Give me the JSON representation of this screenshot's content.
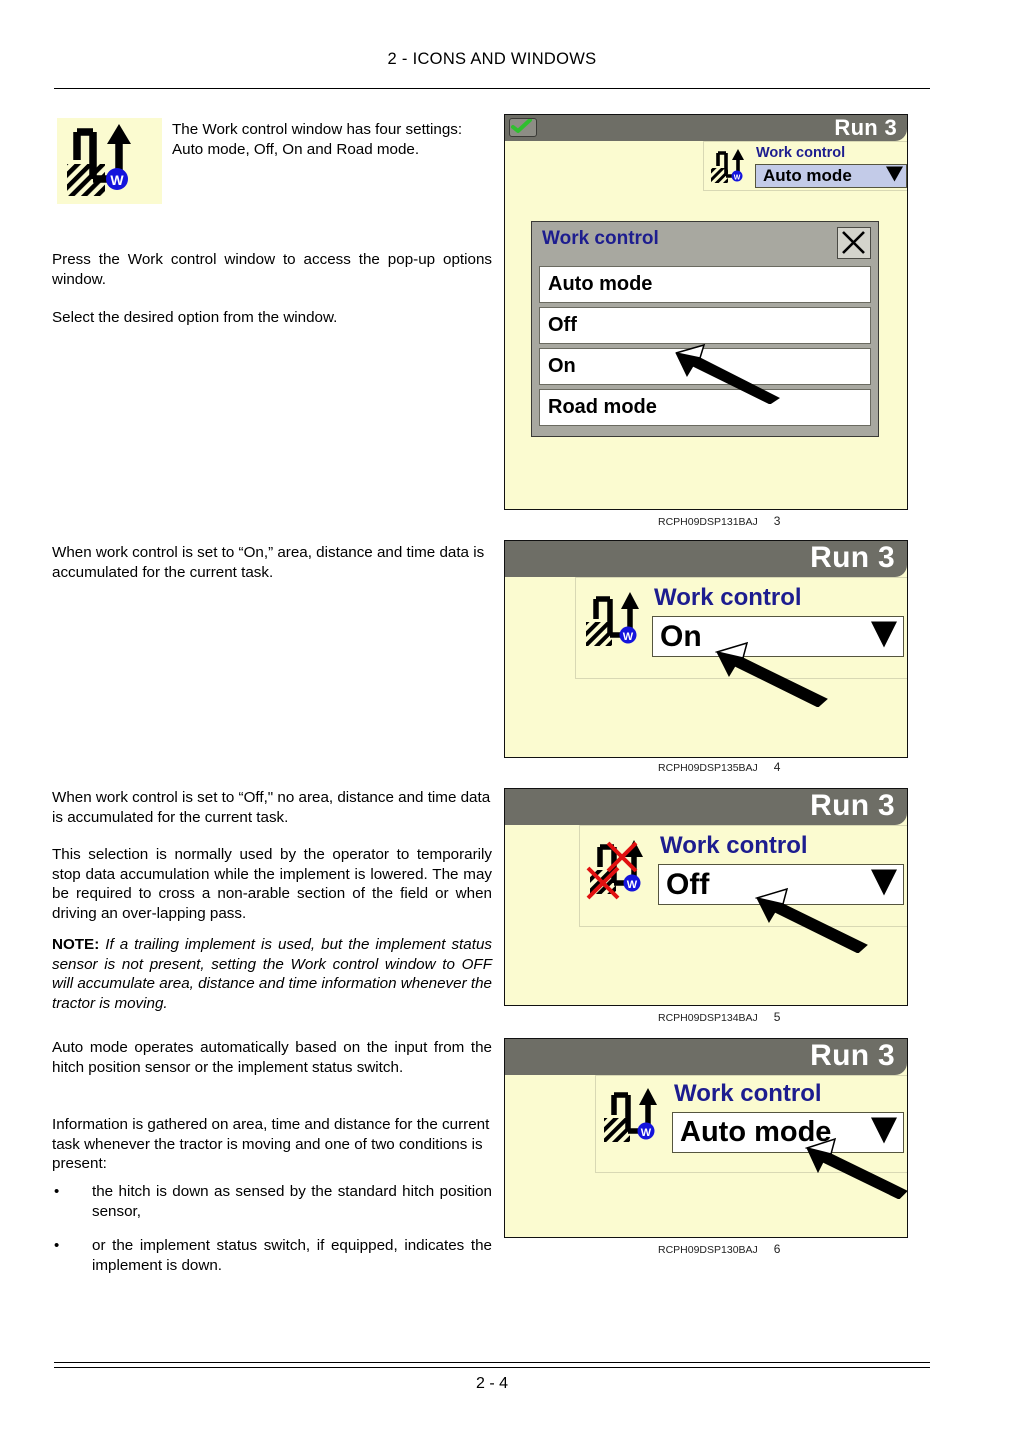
{
  "header": {
    "title": "2 - ICONS AND WINDOWS"
  },
  "footer": {
    "page_number": "2 - 4"
  },
  "body": {
    "intro_paragraph": "The Work control window has four settings: Auto mode, Off, On and Road mode.",
    "paragraph_press": "Press the Work control window to access the pop-up options window.",
    "paragraph_select": "Select the desired option from the window.",
    "paragraph_on": "When work control is set to “On,” area, distance and time data is accumulated for the current task.",
    "paragraph_off": "When work control is set to “Off,\" no area, distance and time data is accumulated for the current task.",
    "paragraph_off_detail": "This selection is normally used by the operator to temporarily stop data accumulation while the implement is lowered. The may be required to cross a non-arable section of the field or when driving an over-lapping pass.",
    "note_label": "NOTE:",
    "note_text": " If a trailing implement is used, but the implement status sensor is not present, setting the Work control window to OFF will accumulate area, distance and time information whenever the tractor is moving.",
    "paragraph_auto": "Auto mode operates automatically based on the input from the hitch position sensor or the implement status switch.",
    "paragraph_info": "Information is gathered on area, time and distance for the current task whenever the tractor is moving and one of two conditions is present:",
    "bullets": [
      {
        "marker": "•",
        "text": "the hitch is down as sensed by the standard hitch position sensor,"
      },
      {
        "marker": "•",
        "text": "or the implement status switch, if equipped, indicates the implement is down."
      }
    ]
  },
  "figures": [
    {
      "id": "figure-3",
      "caption_code": "RCPH09DSP131BAJ",
      "caption_number": "3",
      "titlebar_run": "Run 3",
      "widget_label": "Work control",
      "widget_value": "Auto mode",
      "popup": {
        "title": "Work control",
        "close_label": "×",
        "options": [
          "Auto mode",
          "Off",
          "On",
          "Road mode"
        ]
      }
    },
    {
      "id": "figure-4",
      "caption_code": "RCPH09DSP135BAJ",
      "caption_number": "4",
      "titlebar_run": "Run 3",
      "widget_label": "Work control",
      "widget_value": "On"
    },
    {
      "id": "figure-5",
      "caption_code": "RCPH09DSP134BAJ",
      "caption_number": "5",
      "titlebar_run": "Run 3",
      "widget_label": "Work control",
      "widget_value": "Off"
    },
    {
      "id": "figure-6",
      "caption_code": "RCPH09DSP130BAJ",
      "caption_number": "6",
      "titlebar_run": "Run 3",
      "widget_label": "Work control",
      "widget_value": "Auto mode"
    }
  ],
  "colors": {
    "display_background": "#FBFBD0",
    "titlebar": "#6E6E66",
    "label_blue": "#1D1D8F",
    "selected_field": "#C3CBE8",
    "popup_background": "#A8A8A0",
    "marker_blue": "#1414DC",
    "cross_red": "#E01010",
    "check_green": "#2FBF2F"
  },
  "icons": {
    "work_control": "work-control-icon",
    "work_control_off": "work-control-off-icon",
    "status_ok": "green-check-icon",
    "dropdown": "triangle-down-icon",
    "close": "close-x-icon",
    "pointer": "arrow-pointer-icon"
  }
}
